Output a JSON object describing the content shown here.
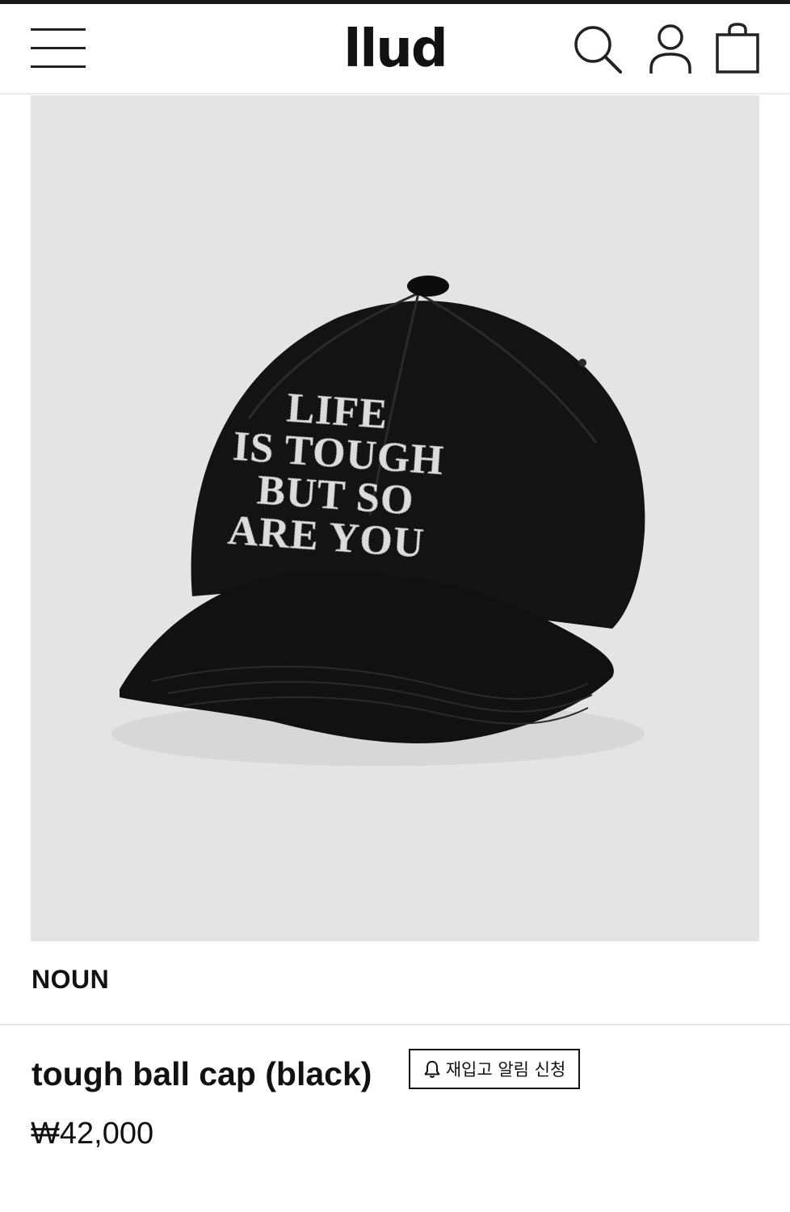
{
  "header": {
    "logo": "llud",
    "menu_icon": "hamburger-menu-icon",
    "search_icon": "search-icon",
    "account_icon": "user-icon",
    "cart_icon": "shopping-bag-icon"
  },
  "product": {
    "image_text": [
      "LIFE",
      "IS TOUGH",
      "BUT SO",
      "ARE YOU"
    ],
    "brand": "NOUN",
    "name": "tough ball cap (black)",
    "restock_label": "재입고 알림 신청",
    "restock_icon": "bell-icon",
    "price": "₩42,000"
  },
  "colors": {
    "image_background": "#e4e4e4",
    "cap": "#121212",
    "embroidery": "#dcdcdc",
    "text": "#111111"
  }
}
